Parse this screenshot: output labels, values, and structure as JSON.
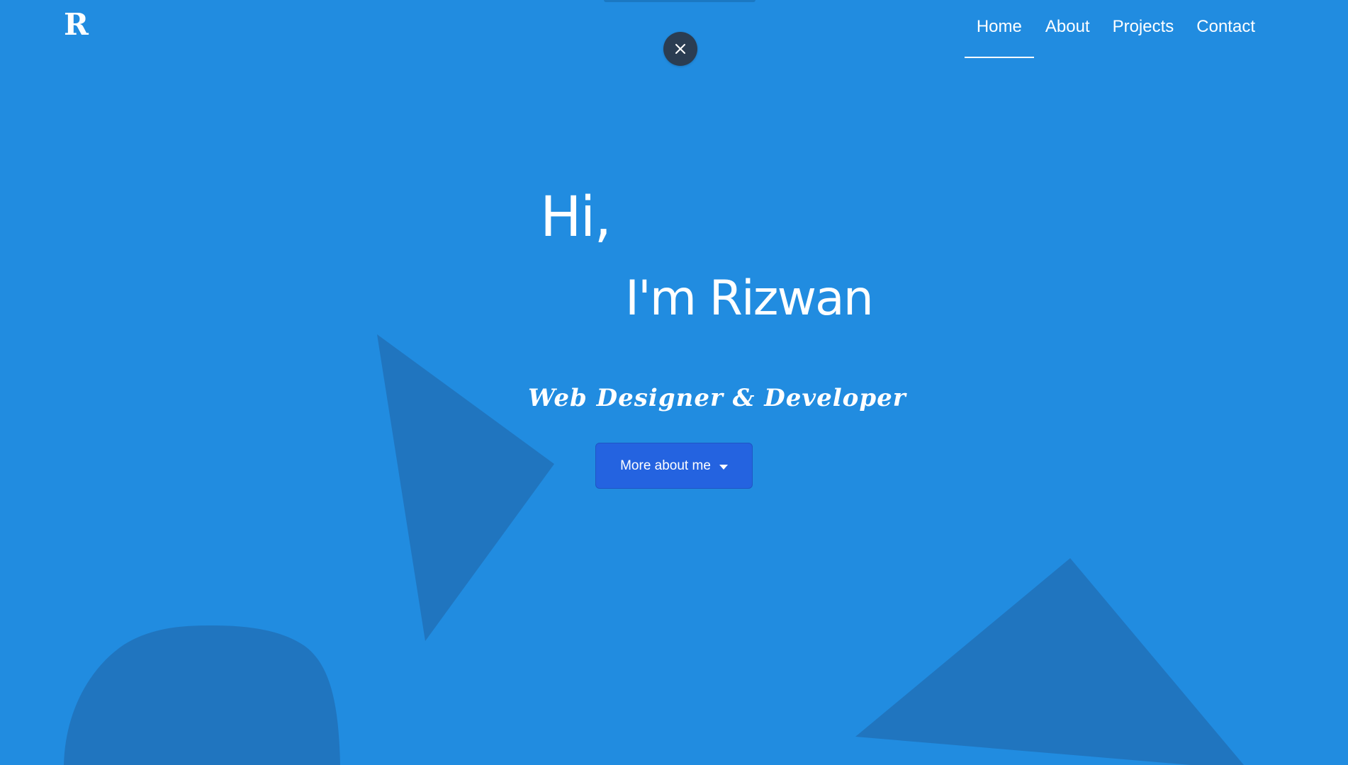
{
  "brand": {
    "logo_letter": "R"
  },
  "nav": {
    "items": [
      {
        "label": "Home",
        "active": true
      },
      {
        "label": "About",
        "active": false
      },
      {
        "label": "Projects",
        "active": false
      },
      {
        "label": "Contact",
        "active": false
      }
    ]
  },
  "overlay": {
    "close_icon": "close-icon"
  },
  "hero": {
    "greeting": "Hi,",
    "name_line": "I'm Rizwan",
    "tagline": "Web Designer & Developer",
    "cta_label": "More about me",
    "cta_icon": "caret-down-icon"
  },
  "colors": {
    "background": "#218ce0",
    "shape": "#2075bf",
    "button": "#2463e0",
    "close_button": "#2b3d52",
    "text": "#ffffff"
  }
}
